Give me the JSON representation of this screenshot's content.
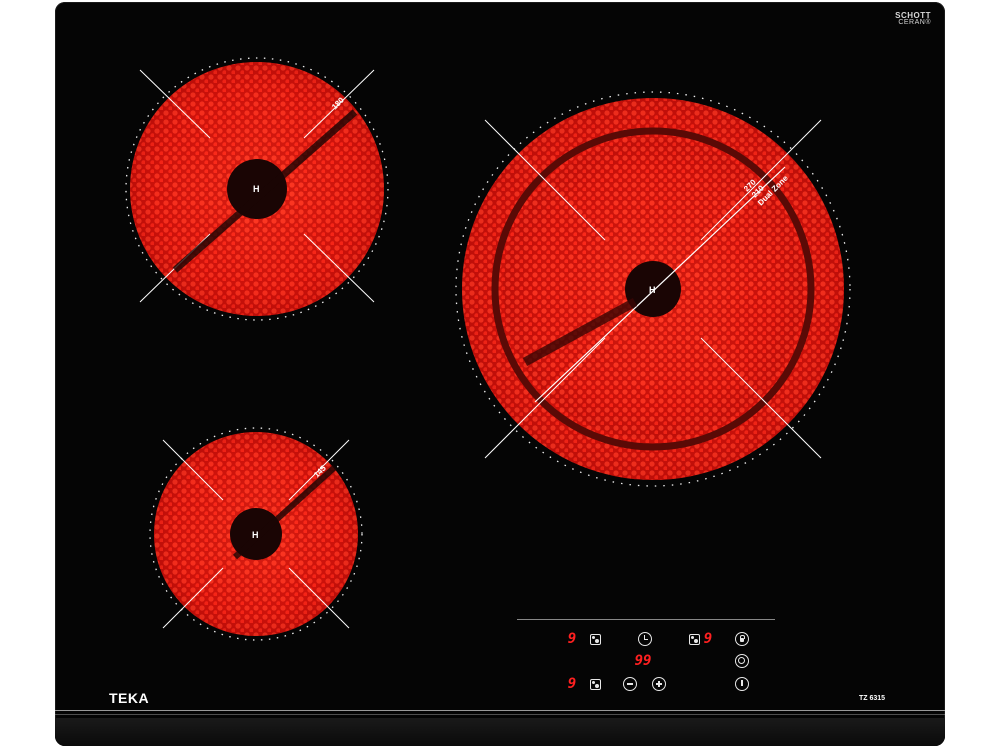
{
  "hob": {
    "brand": "TEKA",
    "model": "TZ 6315",
    "glass_brand_line1": "SCHOTT",
    "glass_brand_line2": "CERAN®",
    "colors": {
      "glass": "#050505",
      "heating_element": "#ff2a1a",
      "ring_mark": "#ffffff",
      "display": "#ff2020"
    }
  },
  "zones": {
    "top_left": {
      "size_label": "180",
      "heat_label": "H"
    },
    "right": {
      "size_label_outer": "270",
      "size_label_inner": "210",
      "type_label": "Dual Zone",
      "heat_label": "H"
    },
    "bottom_left": {
      "size_label": "145",
      "heat_label": "H"
    }
  },
  "controls": {
    "zone_left_top_display": "9",
    "zone_right_display": "9",
    "timer_display": "99",
    "zone_left_bottom_display": "9",
    "icons": {
      "zone_select": "zone-select-icon",
      "timer": "clock-icon",
      "dual_zone": "dual-zone-icon",
      "lock": "lock-icon",
      "dual_ring": "dual-ring-icon",
      "minus": "minus-icon",
      "plus": "plus-icon",
      "power": "power-icon"
    }
  }
}
